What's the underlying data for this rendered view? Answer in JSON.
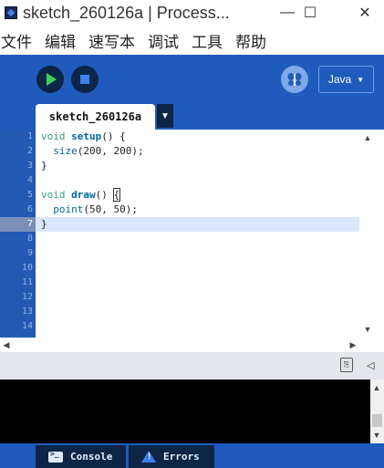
{
  "window": {
    "title": "sketch_260126a | Process...",
    "minimize_glyph": "—",
    "maximize_glyph": "☐",
    "close_glyph": "✕"
  },
  "menu": {
    "items": [
      "文件",
      "编辑",
      "速写本",
      "调试",
      "工具",
      "帮助"
    ]
  },
  "toolbar": {
    "run_icon": "play-icon",
    "stop_icon": "stop-icon",
    "debug_icon": "butterfly-icon",
    "mode": "Java",
    "mode_arrow": "▼"
  },
  "tabs": {
    "active": "sketch_260126a",
    "menu_arrow": "▼"
  },
  "editor": {
    "line_numbers": [
      "1",
      "2",
      "3",
      "4",
      "5",
      "6",
      "7",
      "8",
      "9",
      "10",
      "11",
      "12",
      "13",
      "14"
    ],
    "current_line": 7,
    "code": {
      "l1_kw": "void",
      "l1_fn": "setup",
      "l1_rest": "() {",
      "l2_fn": "size",
      "l2_rest": "(200, 200);",
      "l3": "}",
      "l5_kw": "void",
      "l5_fn": "draw",
      "l5_rest": "() ",
      "l5_brace": "{",
      "l6_fn": "point",
      "l6_rest": "(50, 50);",
      "l7": "}"
    }
  },
  "console": {
    "copy_icon": "copy-icon",
    "collapse_glyph": "◁"
  },
  "bottom_tabs": {
    "console": "Console",
    "errors": "Errors"
  },
  "colors": {
    "toolbar_blue": "#1f5bbd",
    "dark_navy": "#0d2547",
    "run_green": "#3ed35f",
    "keyword": "#33997e",
    "function": "#006699",
    "current_line": "#dae6fb"
  }
}
